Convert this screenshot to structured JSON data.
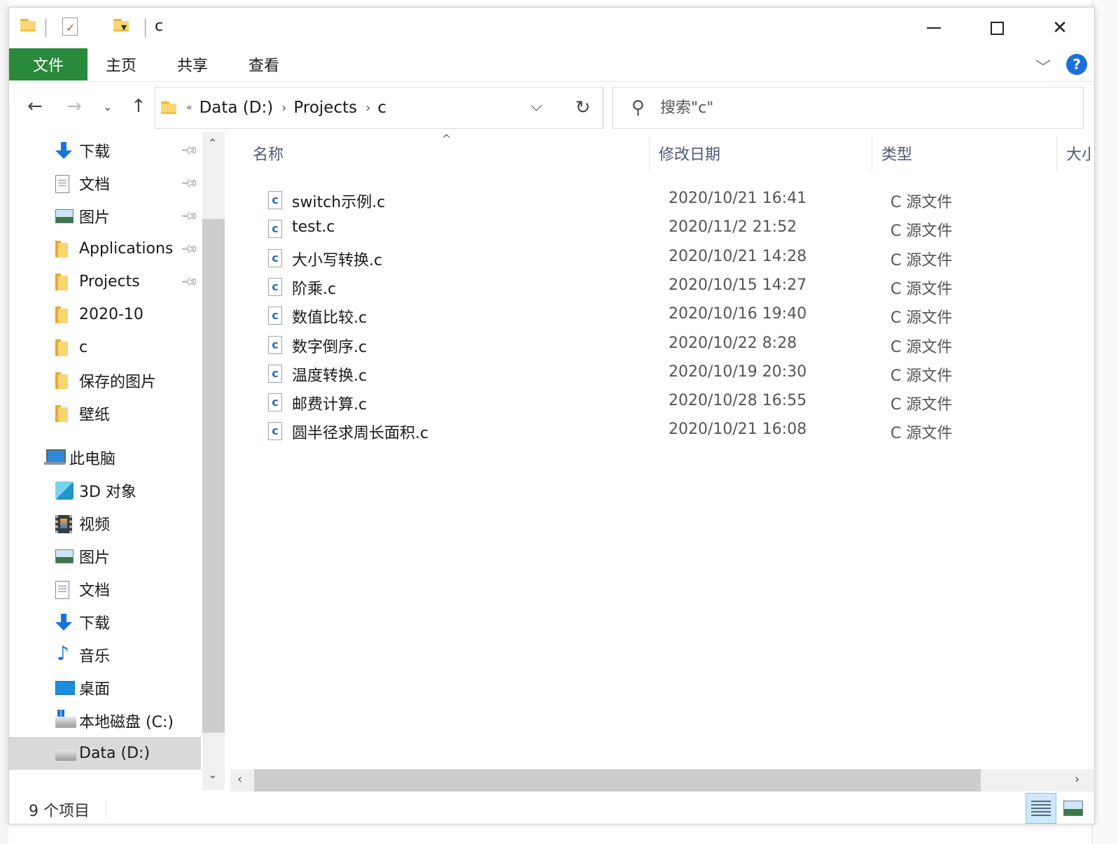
{
  "window": {
    "title": "c",
    "controls": {
      "minimize": "—",
      "maximize": "☐",
      "close": "✕"
    }
  },
  "ribbon": {
    "tabs": [
      {
        "label": "文件"
      },
      {
        "label": "主页"
      },
      {
        "label": "共享"
      },
      {
        "label": "查看"
      }
    ],
    "help": "?"
  },
  "address": {
    "path": [
      "Data (D:)",
      "Projects",
      "c"
    ],
    "overflow": "«"
  },
  "search": {
    "placeholder": "搜索\"c\""
  },
  "nav": {
    "quick_access": [
      {
        "label": "下载",
        "icon": "download-icon",
        "pinned": true
      },
      {
        "label": "文档",
        "icon": "document-icon",
        "pinned": true
      },
      {
        "label": "图片",
        "icon": "pictures-icon",
        "pinned": true
      },
      {
        "label": "Applications",
        "icon": "folder-icon",
        "pinned": true
      },
      {
        "label": "Projects",
        "icon": "folder-icon",
        "pinned": true
      },
      {
        "label": "2020-10",
        "icon": "folder-icon",
        "pinned": false
      },
      {
        "label": "c",
        "icon": "folder-icon",
        "pinned": false
      },
      {
        "label": "保存的图片",
        "icon": "folder-icon",
        "pinned": false
      },
      {
        "label": "壁纸",
        "icon": "folder-icon",
        "pinned": false
      }
    ],
    "this_pc": {
      "label": "此电脑",
      "icon": "computer-icon"
    },
    "pc_items": [
      {
        "label": "3D 对象",
        "icon": "3d-objects-icon"
      },
      {
        "label": "视频",
        "icon": "video-icon"
      },
      {
        "label": "图片",
        "icon": "pictures-icon"
      },
      {
        "label": "文档",
        "icon": "document-icon"
      },
      {
        "label": "下载",
        "icon": "download-icon"
      },
      {
        "label": "音乐",
        "icon": "music-icon"
      },
      {
        "label": "桌面",
        "icon": "desktop-icon"
      },
      {
        "label": "本地磁盘 (C:)",
        "icon": "system-drive-icon"
      },
      {
        "label": "Data (D:)",
        "icon": "drive-icon",
        "selected": true
      }
    ]
  },
  "columns": {
    "name": "名称",
    "date": "修改日期",
    "type": "类型",
    "size": "大小"
  },
  "files": [
    {
      "name": "switch示例.c",
      "date": "2020/10/21 16:41",
      "type": "C 源文件"
    },
    {
      "name": "test.c",
      "date": "2020/11/2 21:52",
      "type": "C 源文件"
    },
    {
      "name": "大小写转换.c",
      "date": "2020/10/21 14:28",
      "type": "C 源文件"
    },
    {
      "name": "阶乘.c",
      "date": "2020/10/15 14:27",
      "type": "C 源文件"
    },
    {
      "name": "数值比较.c",
      "date": "2020/10/16 19:40",
      "type": "C 源文件"
    },
    {
      "name": "数字倒序.c",
      "date": "2020/10/22 8:28",
      "type": "C 源文件"
    },
    {
      "name": "温度转换.c",
      "date": "2020/10/19 20:30",
      "type": "C 源文件"
    },
    {
      "name": "邮费计算.c",
      "date": "2020/10/28 16:55",
      "type": "C 源文件"
    },
    {
      "name": "圆半径求周长面积.c",
      "date": "2020/10/21 16:08",
      "type": "C 源文件"
    }
  ],
  "file_icon_letter": "c",
  "status": {
    "count": "9 个项目"
  },
  "colors": {
    "file_tab": "#2a8a3c",
    "help": "#1c6fd8",
    "selected_nav": "#d9d9d9"
  }
}
